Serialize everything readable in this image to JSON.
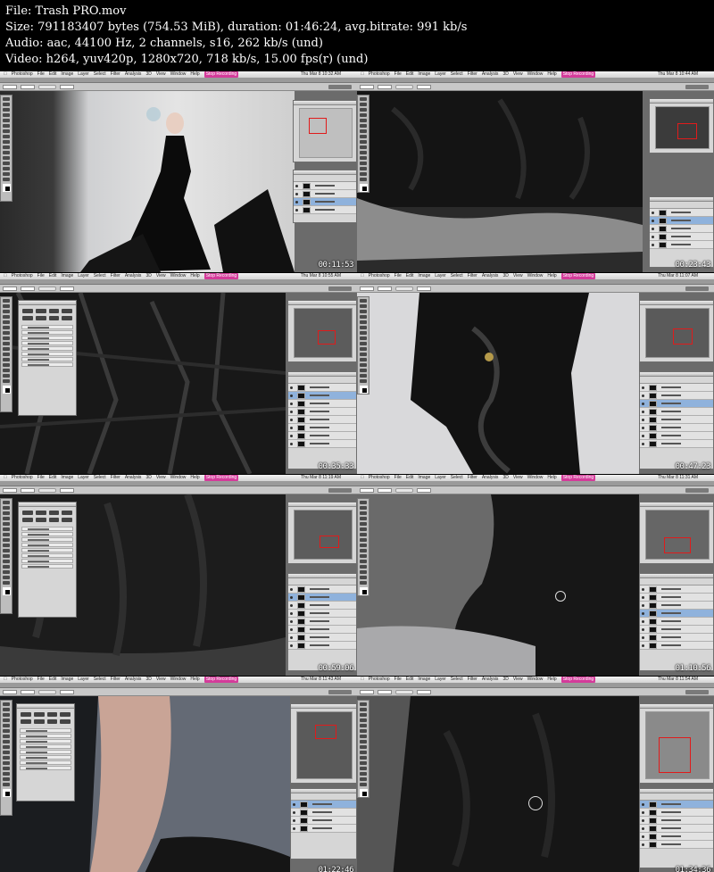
{
  "header": {
    "file": "File: Trash PRO.mov",
    "size": "Size: 791183407 bytes (754.53 MiB), duration: 01:46:24, avg.bitrate: 991 kb/s",
    "audio": "Audio: aac, 44100 Hz, 2 channels, s16, 262 kb/s (und)",
    "video": "Video: h264, yuv420p, 1280x720, 718 kb/s, 15.00 fps(r) (und)"
  },
  "colors": {
    "menubar": "#e0e0e0",
    "record_badge": "#d43b9a",
    "selection_highlight": "#8fb2dc",
    "navigator_box": "#e01b1b",
    "backdrop_gray": "#6b6b6b"
  },
  "frames": [
    {
      "timestamp": "00:11:53",
      "clock": "Thu Mar 8 10:32 AM",
      "scene": "studio-model"
    },
    {
      "timestamp": "00:23:43",
      "clock": "Thu Mar 8 10:44 AM",
      "scene": "dress-base"
    },
    {
      "timestamp": "00:35:33",
      "clock": "Thu Mar 8 10:55 AM",
      "scene": "bag-texture"
    },
    {
      "timestamp": "00:47:23",
      "clock": "Thu Mar 8 11:07 AM",
      "scene": "bag-closeup"
    },
    {
      "timestamp": "00:59:06",
      "clock": "Thu Mar 8 11:19 AM",
      "scene": "dark-drape"
    },
    {
      "timestamp": "01:10:56",
      "clock": "Thu Mar 8 11:31 AM",
      "scene": "dress-brush"
    },
    {
      "timestamp": "01:22:46",
      "clock": "Thu Mar 8 11:43 AM",
      "scene": "arm-closeup"
    },
    {
      "timestamp": "01:34:36",
      "clock": "Thu Mar 8 11:54 AM",
      "scene": "dress-final"
    }
  ],
  "menu": {
    "app": "Photoshop",
    "items": [
      "File",
      "Edit",
      "Image",
      "Layer",
      "Select",
      "Filter",
      "Analysis",
      "3D",
      "View",
      "Window",
      "Help"
    ],
    "recording": "Stop Recording"
  }
}
